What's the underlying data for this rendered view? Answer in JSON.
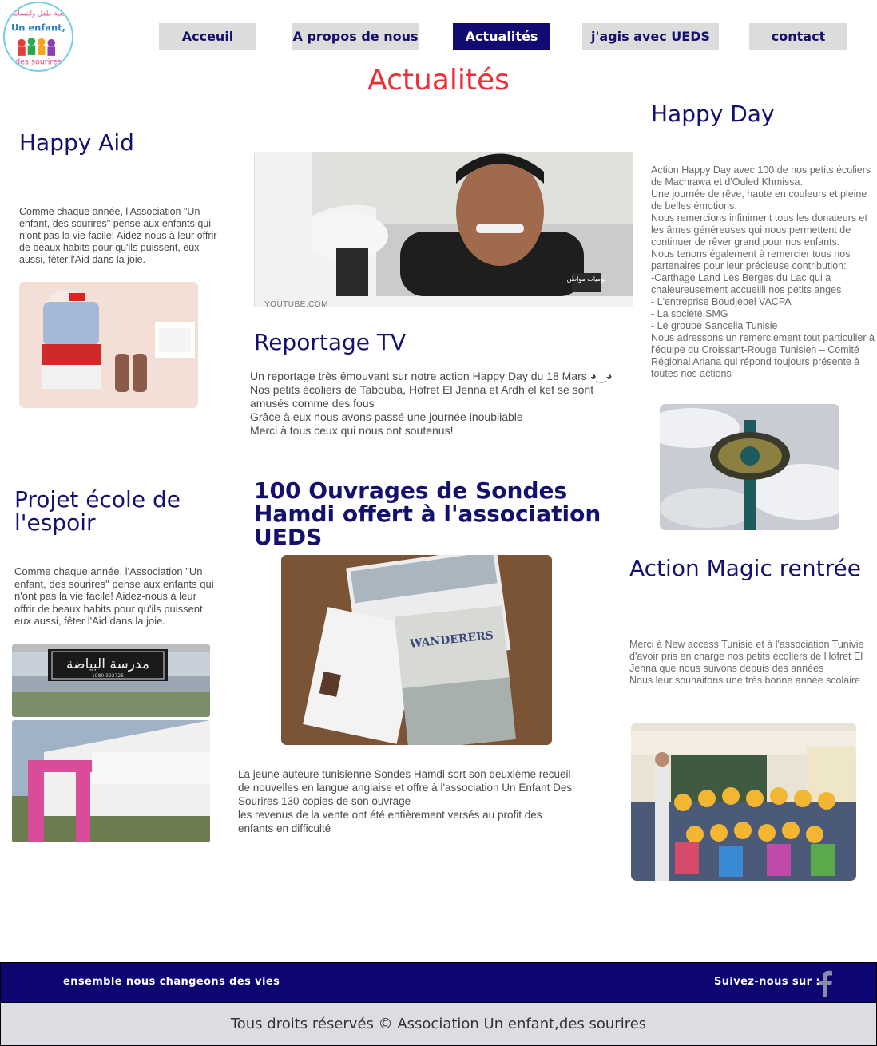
{
  "logo": {
    "arabic_text": "جمعية طفل وابتسامات",
    "latin_text": "Un enfant, des sourires"
  },
  "nav": {
    "items": [
      {
        "label": "Acceuil"
      },
      {
        "label": "A propos de nous"
      },
      {
        "label": "Actualités"
      },
      {
        "label": "j'agis avec UEDS"
      },
      {
        "label": "contact"
      }
    ],
    "active": "Actualités"
  },
  "page_title": "Actualités",
  "happy_aid": {
    "title": "Happy Aid",
    "text": "Comme chaque année, l'Association \"Un enfant, des sourires\" pense aux enfants qui n'ont pas la vie facile! Aidez-nous à leur offrir de beaux habits pour qu'ils puissent, eux aussi, fêter l'Aid dans la joie."
  },
  "video": {
    "source": "YOUTUBE.COM",
    "channel_badge": "يوميات مواطن"
  },
  "reportage": {
    "title": "Reportage TV",
    "lines": [
      "Un reportage très émouvant sur notre action Happy Day du 18 Mars ◕‿◕",
      "Nos petits écoliers de Tabouba, Hofret El Jenna et Ardh el kef se sont amusés comme des fous",
      "Grâce à eux nous avons passé une journée inoubliable ",
      "Merci à tous ceux qui nous ont soutenus!"
    ]
  },
  "happy_day": {
    "title": "Happy Day",
    "lines": [
      "Action Happy Day avec 100 de nos petits écoliers de Machrawa et d'Ouled Khmissa.",
      "Une journée de rêve, haute en couleurs et pleine de belles émotions.",
      "Nous remercions infiniment tous les donateurs et les âmes généreuses qui nous permettent de continuer de rêver grand pour nos enfants.",
      "Nous tenons également à remercier tous nos partenaires pour leur précieuse contribution:",
      "-Carthage Land Les Berges du Lac qui a chaleureusement accueilli nos petits anges",
      "- L'entreprise Boudjebel VACPA",
      "- La société SMG",
      "- Le groupe Sancella Tunisie",
      "Nous adressons un remerciement tout particulier à l'équipe du Croissant-Rouge Tunisien – Comité Régional Ariana qui répond toujours présente à toutes nos actions"
    ]
  },
  "projet_ecole": {
    "title": "Projet école de l'espoir",
    "text": "Comme chaque année, l'Association \"Un enfant, des sourires\" pense aux enfants qui n'ont pas la vie facile! Aidez-nous à leur offrir de beaux habits pour qu'ils puissent, eux aussi, fêter l'Aid dans la joie.",
    "sign_text": "مدرسة البياضة",
    "sign_numbers": "1980    322725"
  },
  "ouvrages": {
    "title": "100 Ouvrages de Sondes Hamdi offert à l'association UEDS",
    "lines": [
      "La jeune auteure tunisienne Sondes Hamdi sort son deuxième recueil de nouvelles en langue anglaise et offre à l'association Un Enfant Des Sourires 130 copies de son ouvrage  ",
      "les revenus de la vente ont été entièrement versés au profit des enfants en difficulté "
    ],
    "book_title": "WANDERERS"
  },
  "magic_rentree": {
    "title": " Action Magic rentrée",
    "lines": [
      "Merci à New access Tunisie et à l'association Tunivie d'avoir pris en charge nos petits écoliers de Hofret El Jenna que nous suivons depuis des années ",
      "Nous leur souhaitons une très bonne année scolaire "
    ]
  },
  "footer": {
    "tagline": "ensemble nous changeons des vies",
    "follow": "Suivez-nous sur :",
    "copyright": "Tous droits réservés © Association Un enfant,des sourires"
  },
  "colors": {
    "navy": "#120a73",
    "red_title": "#ee2d35",
    "nav_bg": "#dcdcdc",
    "footer_bottom": "#dcdde3"
  }
}
